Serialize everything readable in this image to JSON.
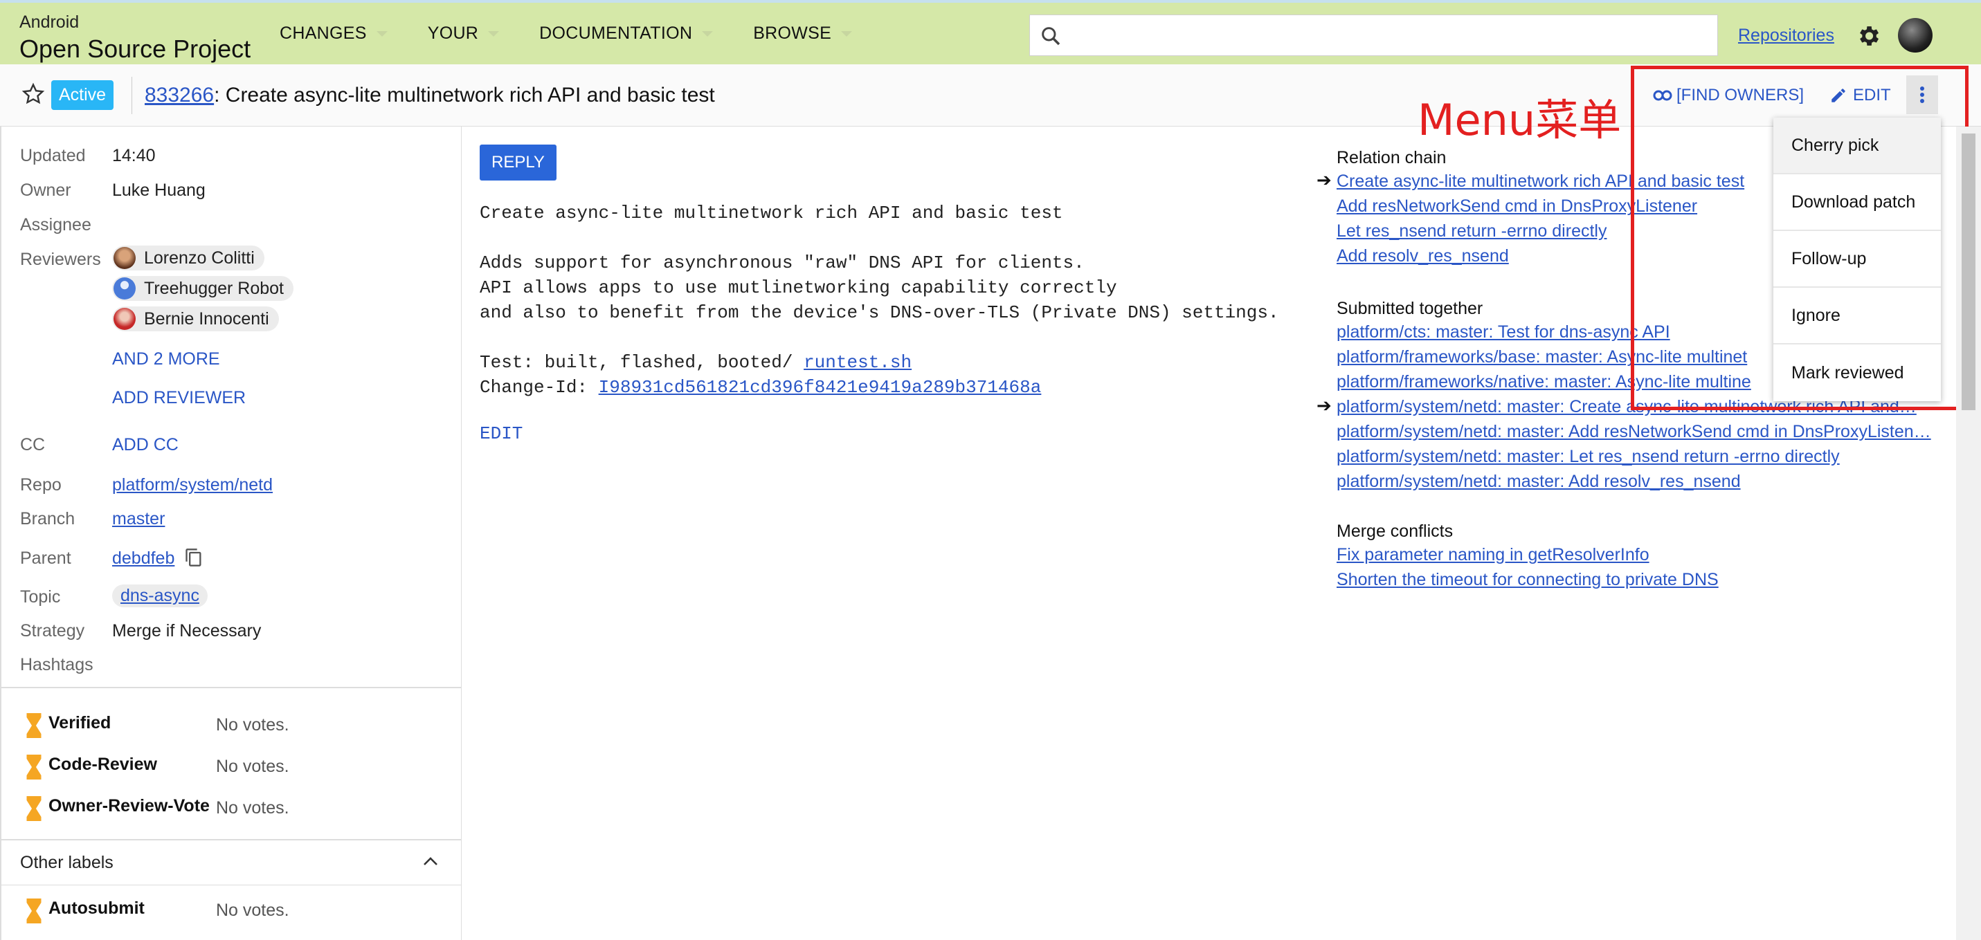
{
  "header": {
    "brand_small": "Android",
    "brand_big": "Open Source Project",
    "nav": [
      "CHANGES",
      "YOUR",
      "DOCUMENTATION",
      "BROWSE"
    ],
    "repositories": "Repositories"
  },
  "change": {
    "status": "Active",
    "number": "833266",
    "title": ": Create async-lite multinetwork rich API and basic test",
    "find_owners": "[FIND OWNERS]",
    "edit": "EDIT"
  },
  "annotation": "Menu菜单",
  "info": {
    "updated_label": "Updated",
    "updated": "14:40",
    "owner_label": "Owner",
    "owner": "Luke Huang",
    "assignee_label": "Assignee",
    "reviewers_label": "Reviewers",
    "reviewers": [
      "Lorenzo Colitti",
      "Treehugger Robot",
      "Bernie Innocenti"
    ],
    "and_more": "AND 2 MORE",
    "add_reviewer": "ADD REVIEWER",
    "cc_label": "CC",
    "add_cc": "ADD CC",
    "repo_label": "Repo",
    "repo": "platform/system/netd",
    "branch_label": "Branch",
    "branch": "master",
    "parent_label": "Parent",
    "parent": "debdfeb",
    "topic_label": "Topic",
    "topic": "dns-async",
    "strategy_label": "Strategy",
    "strategy": "Merge if Necessary",
    "hashtags_label": "Hashtags"
  },
  "labels": [
    {
      "name": "Verified",
      "votes": "No votes."
    },
    {
      "name": "Code-Review",
      "votes": "No votes."
    },
    {
      "name": "Owner-Review-Vote",
      "votes": "No votes."
    }
  ],
  "other_labels": {
    "title": "Other labels",
    "items": [
      {
        "name": "Autosubmit",
        "votes": "No votes."
      }
    ]
  },
  "message": {
    "reply": "REPLY",
    "line1": "Create async-lite multinetwork rich API and basic test",
    "line3": "Adds support for asynchronous \"raw\" DNS API for clients.",
    "line4": "API allows apps to use mutlinetworking capability correctly",
    "line5": "and also to benefit from the device's DNS-over-TLS (Private DNS) settings.",
    "test_prefix": "Test: built, flashed, booted/ ",
    "test_link": "runtest.sh",
    "changeid_prefix": "Change-Id: ",
    "changeid": "I98931cd561821cd396f8421e9419a289b371468a",
    "edit": "EDIT"
  },
  "relation_chain": {
    "title": "Relation chain",
    "items": [
      "Create async-lite multinetwork rich API and basic test",
      "Add resNetworkSend cmd in DnsProxyListener",
      "Let res_nsend return -errno directly",
      "Add resolv_res_nsend"
    ]
  },
  "submitted_together": {
    "title": "Submitted together",
    "items": [
      "platform/cts: master: Test for dns-async API",
      "platform/frameworks/base: master: Async-lite multinet",
      "platform/frameworks/native: master: Async-lite multine",
      "platform/system/netd: master: Create async-lite multinetwork rich API and…",
      "platform/system/netd: master: Add resNetworkSend cmd in DnsProxyListen…",
      "platform/system/netd: master: Let res_nsend return -errno directly",
      "platform/system/netd: master: Add resolv_res_nsend"
    ]
  },
  "merge_conflicts": {
    "title": "Merge conflicts",
    "items": [
      "Fix parameter naming in getResolverInfo",
      "Shorten the timeout for connecting to private DNS"
    ]
  },
  "menu": [
    "Cherry pick",
    "Download patch",
    "Follow-up",
    "Ignore",
    "Mark reviewed"
  ],
  "colors": {
    "header_bg": "#d5e8a8",
    "link": "#2a56c6",
    "active_badge": "#29b6f6",
    "annotation": "#e32020"
  }
}
